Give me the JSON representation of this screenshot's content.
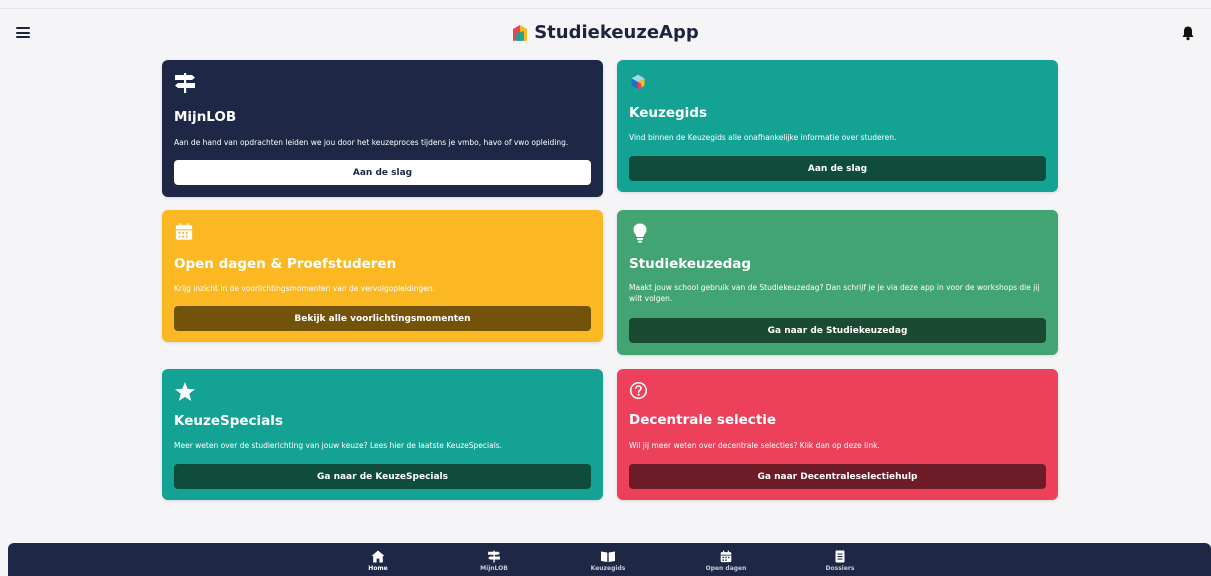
{
  "header": {
    "title": "StudiekeuzeApp",
    "menu_icon": "hamburger-icon",
    "notification_icon": "bell-icon"
  },
  "cards": [
    {
      "title": "MijnLOB",
      "icon": "signpost-icon",
      "description": "Aan de hand van opdrachten leiden we jou door het keuzeproces tijdens je vmbo, havo of vwo opleiding.",
      "button": "Aan de slag"
    },
    {
      "title": "Keuzegids",
      "icon": "cube-icon",
      "description": "Vind binnen de Keuzegids alle onafhankelijke informatie over studeren.",
      "button": "Aan de slag"
    },
    {
      "title": "Open dagen & Proefstuderen",
      "icon": "calendar-icon",
      "description": "Krijg inzicht in de voorlichtingsmomenten van de vervolgopleidingen.",
      "button": "Bekijk alle voorlichtingsmomenten"
    },
    {
      "title": "Studiekeuzedag",
      "icon": "lightbulb-icon",
      "description": "Maakt jouw school gebruik van de Studiekeuzedag? Dan schrijf je je via deze app in voor de workshops die jij wilt volgen.",
      "button": "Ga naar de Studiekeuzedag"
    },
    {
      "title": "KeuzeSpecials",
      "icon": "star-icon",
      "description": "Meer weten over de studierichting van jouw keuze? Lees hier de laatste KeuzeSpecials.",
      "button": "Ga naar de KeuzeSpecials"
    },
    {
      "title": "Decentrale selectie",
      "icon": "question-circle-icon",
      "description": "Wil jij meer weten over decentrale selecties? Klik dan op deze link.",
      "button": "Ga naar Decentraleselectiehulp"
    }
  ],
  "bottom_nav": [
    {
      "label": "Home",
      "icon": "home-icon",
      "active": true
    },
    {
      "label": "MijnLOB",
      "icon": "signpost-icon"
    },
    {
      "label": "Keuzegids",
      "icon": "book-icon"
    },
    {
      "label": "Open dagen",
      "icon": "calendar-icon"
    },
    {
      "label": "Dossiers",
      "icon": "document-icon"
    }
  ],
  "colors": {
    "navy": "#1e2846",
    "teal": "#14a295",
    "yellow": "#fcb822",
    "green": "#42a472",
    "red": "#ec405b",
    "background": "#f5f5f7"
  }
}
